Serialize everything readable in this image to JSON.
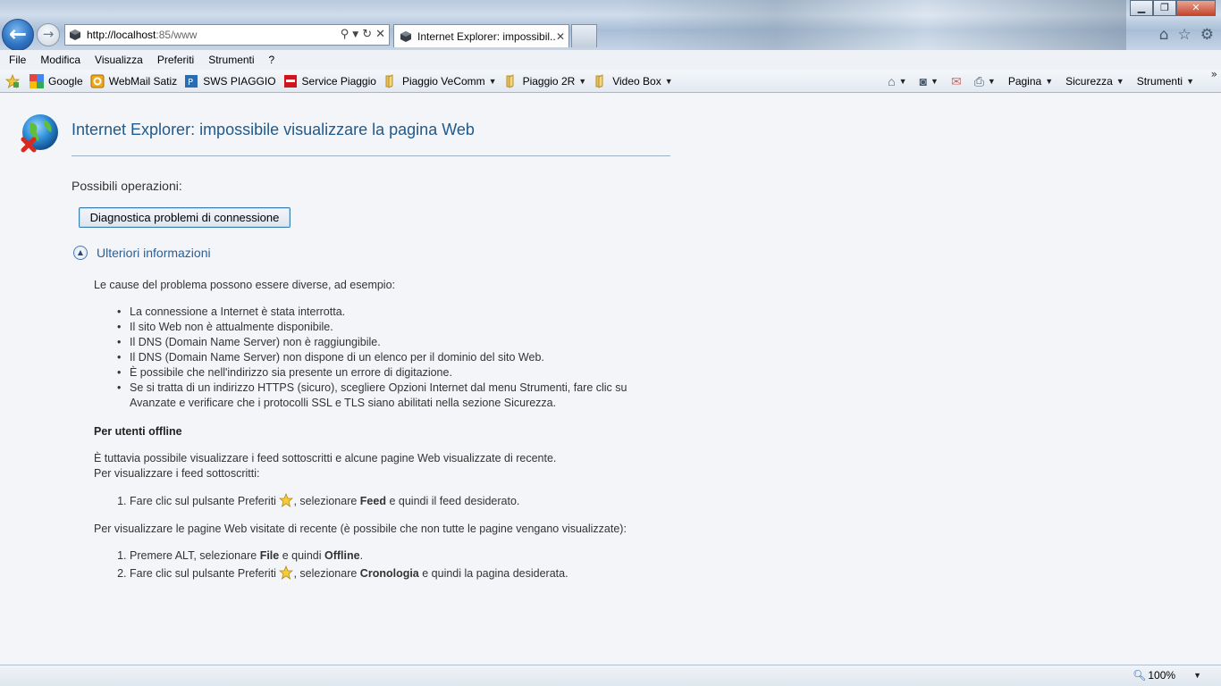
{
  "window": {
    "address_url_host": "http://localhost",
    "address_url_rest": ":85/www",
    "tab_title": "Internet Explorer: impossibil...",
    "tab_close": "✕",
    "minimize": "▁",
    "maximize": "❐",
    "close": "✕"
  },
  "menu": [
    "File",
    "Modifica",
    "Visualizza",
    "Preferiti",
    "Strumenti",
    "?"
  ],
  "favorites": [
    {
      "label": "Google",
      "icon": "google-icon",
      "dropdown": false
    },
    {
      "label": "WebMail Satiz",
      "icon": "webmail-icon",
      "dropdown": false
    },
    {
      "label": "SWS PIAGGIO",
      "icon": "sws-icon",
      "dropdown": false
    },
    {
      "label": "Service Piaggio",
      "icon": "service-icon",
      "dropdown": false
    },
    {
      "label": "Piaggio VeComm",
      "icon": "folder-icon",
      "dropdown": true
    },
    {
      "label": "Piaggio 2R",
      "icon": "folder-icon",
      "dropdown": true
    },
    {
      "label": "Video Box",
      "icon": "folder-icon",
      "dropdown": true
    }
  ],
  "commands": {
    "page": "Pagina",
    "security": "Sicurezza",
    "tools": "Strumenti"
  },
  "content": {
    "title": "Internet Explorer: impossibile visualizzare la pagina Web",
    "ops_label": "Possibili operazioni:",
    "diag_button": "Diagnostica problemi di connessione",
    "more_info": "Ulteriori informazioni",
    "causes_intro": "Le cause del problema possono essere diverse, ad esempio:",
    "causes": [
      "La connessione a Internet è stata interrotta.",
      "Il sito Web non è attualmente disponibile.",
      "Il DNS (Domain Name Server) non è raggiungibile.",
      "Il DNS (Domain Name Server) non dispone di un elenco per il dominio del sito Web.",
      "È possibile che nell'indirizzo sia presente un errore di digitazione.",
      "Se si tratta di un indirizzo HTTPS (sicuro), scegliere Opzioni Internet dal menu Strumenti, fare clic su Avanzate e verificare che i protocolli SSL e TLS siano abilitati nella sezione Sicurezza."
    ],
    "offline_heading": "Per utenti offline",
    "offline_text1": "È tuttavia possibile visualizzare i feed sottoscritti e alcune pagine Web visualizzate di recente.",
    "offline_text2": "Per visualizzare i feed sottoscritti:",
    "feed_step": {
      "a": "Fare clic sul pulsante Preferiti ",
      "b": ", selezionare ",
      "bold": "Feed",
      "c": " e quindi il feed desiderato."
    },
    "recent_intro": "Per visualizzare le pagine Web visitate di recente (è possibile che non tutte le pagine vengano visualizzate):",
    "recent_step1": {
      "a": "Premere ALT, selezionare ",
      "bold1": "File",
      "b": " e quindi ",
      "bold2": "Offline",
      "c": "."
    },
    "recent_step2": {
      "a": "Fare clic sul pulsante Preferiti ",
      "b": ", selezionare ",
      "bold": "Cronologia",
      "c": " e quindi la pagina desiderata."
    }
  },
  "status": {
    "zoom": "100%"
  }
}
